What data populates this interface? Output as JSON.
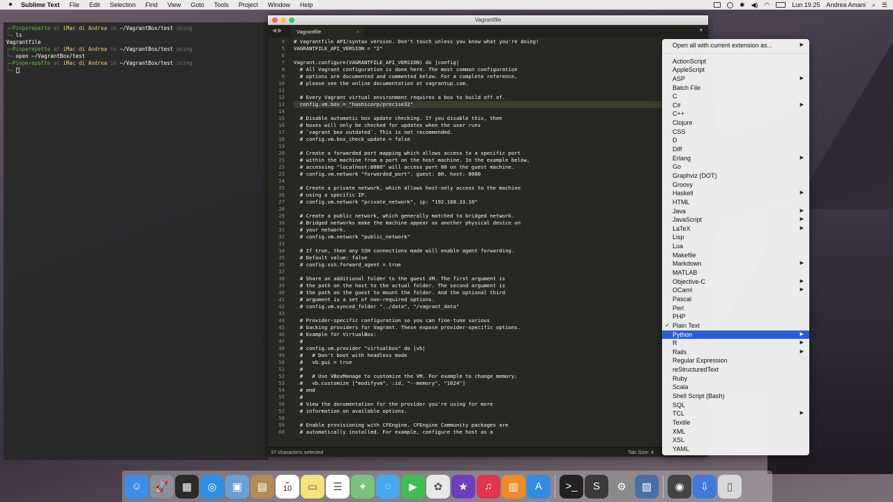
{
  "menubar": {
    "apple_icon": "apple-icon",
    "app_name": "Sublime Text",
    "items": [
      "File",
      "Edit",
      "Selection",
      "Find",
      "View",
      "Goto",
      "Tools",
      "Project",
      "Window",
      "Help"
    ],
    "clock": "Lun 19.25",
    "user": "Andrea Amani"
  },
  "terminal": {
    "lines": [
      {
        "user": "Pinperepette",
        "at": "at",
        "host": "iMac di Andrea",
        "in": "in",
        "path": "~/VagrantBox/test",
        "using": "using"
      },
      {
        "cmd": "ls"
      },
      {
        "out": "Vagrantfile"
      },
      {
        "user": "Pinperepette",
        "at": "at",
        "host": "iMac di Andrea",
        "in": "in",
        "path": "~/VagrantBox/test",
        "using": "using"
      },
      {
        "cmd": "open ~/VagrantBox/test"
      },
      {
        "user": "Pinperepette",
        "at": "at",
        "host": "iMac di Andrea",
        "in": "in",
        "path": "~/VagrantBox/test",
        "using": "using"
      }
    ]
  },
  "sublime": {
    "window_title": "Vagrantfile",
    "tab_label": "Vagrantfile",
    "tab_close": "×",
    "status_left": "37 characters selected",
    "status_tabsize": "Tab Size: 4",
    "lines": [
      {
        "n": "4",
        "t": "# Vagrantfile API/syntax version. Don't touch unless you know what you're doing!"
      },
      {
        "n": "5",
        "t": "VAGRANTFILE_API_VERSION = \"2\""
      },
      {
        "n": "6",
        "t": ""
      },
      {
        "n": "7",
        "t": "Vagrant.configure(VAGRANTFILE_API_VERSION) do |config|"
      },
      {
        "n": "8",
        "t": "  # All Vagrant configuration is done here. The most common configuration"
      },
      {
        "n": "9",
        "t": "  # options are documented and commented below. For a complete reference,"
      },
      {
        "n": "10",
        "t": "  # please see the online documentation at vagrantup.com."
      },
      {
        "n": "11",
        "t": ""
      },
      {
        "n": "12",
        "t": "  # Every Vagrant virtual environment requires a box to build off of."
      },
      {
        "n": "13",
        "t": "  config.vm.box = \"hashicorp/precise32\""
      },
      {
        "n": "14",
        "t": ""
      },
      {
        "n": "15",
        "t": "  # Disable automatic box update checking. If you disable this, then"
      },
      {
        "n": "16",
        "t": "  # boxes will only be checked for updates when the user runs"
      },
      {
        "n": "17",
        "t": "  # `vagrant box outdated`. This is not recommended."
      },
      {
        "n": "18",
        "t": "  # config.vm.box_check_update = false"
      },
      {
        "n": "19",
        "t": ""
      },
      {
        "n": "20",
        "t": "  # Create a forwarded port mapping which allows access to a specific port"
      },
      {
        "n": "21",
        "t": "  # within the machine from a port on the host machine. In the example below,"
      },
      {
        "n": "22",
        "t": "  # accessing \"localhost:8080\" will access port 80 on the guest machine."
      },
      {
        "n": "23",
        "t": "  # config.vm.network \"forwarded_port\", guest: 80, host: 8080"
      },
      {
        "n": "24",
        "t": ""
      },
      {
        "n": "25",
        "t": "  # Create a private network, which allows host-only access to the machine"
      },
      {
        "n": "26",
        "t": "  # using a specific IP."
      },
      {
        "n": "27",
        "t": "  # config.vm.network \"private_network\", ip: \"192.168.33.10\""
      },
      {
        "n": "28",
        "t": ""
      },
      {
        "n": "29",
        "t": "  # Create a public network, which generally matched to bridged network."
      },
      {
        "n": "30",
        "t": "  # Bridged networks make the machine appear as another physical device on"
      },
      {
        "n": "31",
        "t": "  # your network."
      },
      {
        "n": "32",
        "t": "  # config.vm.network \"public_network\""
      },
      {
        "n": "33",
        "t": ""
      },
      {
        "n": "34",
        "t": "  # If true, then any SSH connections made will enable agent forwarding."
      },
      {
        "n": "35",
        "t": "  # Default value: false"
      },
      {
        "n": "36",
        "t": "  # config.ssh.forward_agent = true"
      },
      {
        "n": "37",
        "t": ""
      },
      {
        "n": "38",
        "t": "  # Share an additional folder to the guest VM. The first argument is"
      },
      {
        "n": "39",
        "t": "  # the path on the host to the actual folder. The second argument is"
      },
      {
        "n": "40",
        "t": "  # the path on the guest to mount the folder. And the optional third"
      },
      {
        "n": "41",
        "t": "  # argument is a set of non-required options."
      },
      {
        "n": "42",
        "t": "  # config.vm.synced_folder \"../data\", \"/vagrant_data\""
      },
      {
        "n": "43",
        "t": ""
      },
      {
        "n": "44",
        "t": "  # Provider-specific configuration so you can fine-tune various"
      },
      {
        "n": "45",
        "t": "  # backing providers for Vagrant. These expose provider-specific options."
      },
      {
        "n": "46",
        "t": "  # Example for VirtualBox:"
      },
      {
        "n": "47",
        "t": "  #"
      },
      {
        "n": "48",
        "t": "  # config.vm.provider \"virtualbox\" do |vb|"
      },
      {
        "n": "49",
        "t": "  #   # Don't boot with headless mode"
      },
      {
        "n": "50",
        "t": "  #   vb.gui = true"
      },
      {
        "n": "51",
        "t": "  #"
      },
      {
        "n": "52",
        "t": "  #   # Use VBoxManage to customize the VM. For example to change memory:"
      },
      {
        "n": "53",
        "t": "  #   vb.customize [\"modifyvm\", :id, \"--memory\", \"1024\"]"
      },
      {
        "n": "54",
        "t": "  # end"
      },
      {
        "n": "55",
        "t": "  #"
      },
      {
        "n": "56",
        "t": "  # View the documentation for the provider you're using for more"
      },
      {
        "n": "57",
        "t": "  # information on available options."
      },
      {
        "n": "58",
        "t": ""
      },
      {
        "n": "59",
        "t": "  # Enable provisioning with CFEngine. CFEngine Community packages are"
      },
      {
        "n": "60",
        "t": "  # automatically installed. For example, configure the host as a"
      }
    ]
  },
  "syntax_menu": {
    "header": "Open all with current extension as...",
    "items": [
      {
        "label": "ActionScript",
        "sub": false
      },
      {
        "label": "AppleScript",
        "sub": false
      },
      {
        "label": "ASP",
        "sub": true
      },
      {
        "label": "Batch File",
        "sub": false
      },
      {
        "label": "C",
        "sub": false
      },
      {
        "label": "C#",
        "sub": true
      },
      {
        "label": "C++",
        "sub": false
      },
      {
        "label": "Clojure",
        "sub": false
      },
      {
        "label": "CSS",
        "sub": false
      },
      {
        "label": "D",
        "sub": false
      },
      {
        "label": "Diff",
        "sub": false
      },
      {
        "label": "Erlang",
        "sub": true
      },
      {
        "label": "Go",
        "sub": false
      },
      {
        "label": "Graphviz (DOT)",
        "sub": false
      },
      {
        "label": "Groovy",
        "sub": false
      },
      {
        "label": "Haskell",
        "sub": true
      },
      {
        "label": "HTML",
        "sub": false
      },
      {
        "label": "Java",
        "sub": true
      },
      {
        "label": "JavaScript",
        "sub": true
      },
      {
        "label": "LaTeX",
        "sub": true
      },
      {
        "label": "Lisp",
        "sub": false
      },
      {
        "label": "Lua",
        "sub": false
      },
      {
        "label": "Makefile",
        "sub": false
      },
      {
        "label": "Markdown",
        "sub": true
      },
      {
        "label": "MATLAB",
        "sub": false
      },
      {
        "label": "Objective-C",
        "sub": true
      },
      {
        "label": "OCaml",
        "sub": true
      },
      {
        "label": "Pascal",
        "sub": false
      },
      {
        "label": "Perl",
        "sub": false
      },
      {
        "label": "PHP",
        "sub": false
      },
      {
        "label": "Plain Text",
        "sub": false,
        "checked": true
      },
      {
        "label": "Python",
        "sub": true,
        "active": true
      },
      {
        "label": "R",
        "sub": true
      },
      {
        "label": "Rails",
        "sub": true
      },
      {
        "label": "Regular Expression",
        "sub": false
      },
      {
        "label": "reStructuredText",
        "sub": false
      },
      {
        "label": "Ruby",
        "sub": false
      },
      {
        "label": "Scala",
        "sub": false
      },
      {
        "label": "Shell Script (Bash)",
        "sub": false
      },
      {
        "label": "SQL",
        "sub": false
      },
      {
        "label": "TCL",
        "sub": true
      },
      {
        "label": "Textile",
        "sub": false
      },
      {
        "label": "XML",
        "sub": false
      },
      {
        "label": "XSL",
        "sub": false
      },
      {
        "label": "YAML",
        "sub": false
      }
    ],
    "check_glyph": "✓",
    "arrow_glyph": "▶"
  },
  "dock": {
    "calendar_day": "10",
    "icons": [
      {
        "name": "finder-icon",
        "color": "#3b8ee8",
        "glyph": "☺"
      },
      {
        "name": "launchpad-icon",
        "color": "#8a8f9a",
        "glyph": "🚀"
      },
      {
        "name": "mission-control-icon",
        "color": "#2a2a2a",
        "glyph": "▦"
      },
      {
        "name": "safari-icon",
        "color": "#2f8de4",
        "glyph": "◎"
      },
      {
        "name": "preview-icon",
        "color": "#6aa0d8",
        "glyph": "▣"
      },
      {
        "name": "contacts-icon",
        "color": "#b58b55",
        "glyph": "▤"
      },
      {
        "name": "calendar-icon",
        "color": "#ffffff",
        "glyph": ""
      },
      {
        "name": "notes-icon",
        "color": "#f4e27a",
        "glyph": "▭"
      },
      {
        "name": "reminders-icon",
        "color": "#ffffff",
        "glyph": "☰"
      },
      {
        "name": "maps-icon",
        "color": "#7ac47a",
        "glyph": "✦"
      },
      {
        "name": "messages-icon",
        "color": "#4aa8f0",
        "glyph": "◌"
      },
      {
        "name": "facetime-icon",
        "color": "#3fbf4f",
        "glyph": "▶"
      },
      {
        "name": "photos-icon",
        "color": "#e8e8e8",
        "glyph": "✿"
      },
      {
        "name": "imovie-icon",
        "color": "#6b3fbf",
        "glyph": "★"
      },
      {
        "name": "itunes-icon",
        "color": "#e2334f",
        "glyph": "♫"
      },
      {
        "name": "ibooks-icon",
        "color": "#f08a24",
        "glyph": "▥"
      },
      {
        "name": "app-store-icon",
        "color": "#2f8de4",
        "glyph": "A"
      },
      {
        "name": "terminal-icon",
        "color": "#222222",
        "glyph": ">_"
      },
      {
        "name": "sublime-icon",
        "color": "#3a3a3a",
        "glyph": "S"
      },
      {
        "name": "archive-icon",
        "color": "#8a8a8a",
        "glyph": "⚙"
      },
      {
        "name": "claquette-icon",
        "color": "#4a6fa8",
        "glyph": "▨"
      },
      {
        "name": "fingerprint-icon",
        "color": "#444444",
        "glyph": "◉"
      },
      {
        "name": "downloads-icon",
        "color": "#3f7ad8",
        "glyph": "⇩"
      },
      {
        "name": "trash-icon",
        "color": "#d8d8d8",
        "glyph": "▯"
      }
    ]
  }
}
